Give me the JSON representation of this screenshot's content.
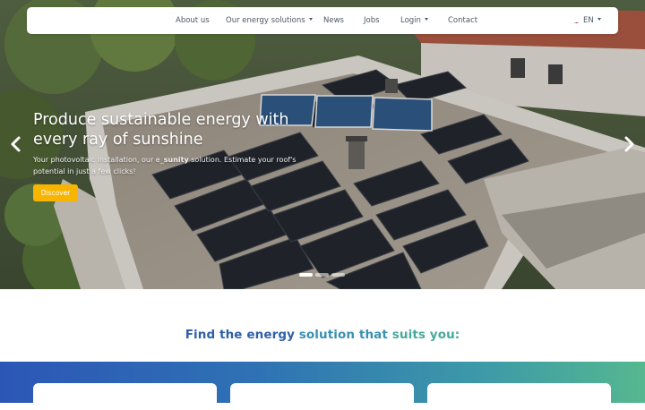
{
  "nav": {
    "items": [
      {
        "label": "About us"
      },
      {
        "label": "Our energy solutions"
      },
      {
        "label": "News"
      },
      {
        "label": "Jobs"
      },
      {
        "label": "Login"
      },
      {
        "label": "Contact"
      }
    ],
    "language": "EN"
  },
  "hero": {
    "title": "Produce sustainable energy with every ray of sunshine",
    "description_pre": "Your photovoltaic installation, our e_",
    "description_bold": "sunity",
    "description_post": " solution. Estimate your roof's potential in just a few clicks!",
    "cta_label": "Discover",
    "active_slide": 1,
    "slide_count": 3
  },
  "section": {
    "title_part1": "Find the energy ",
    "title_part2": "solution that ",
    "title_part3": "suits you:"
  },
  "colors": {
    "accent": "#f7b500",
    "heading_blue": "#2f5fa8",
    "heading_teal": "#46a99a",
    "band_start": "#2c56b6",
    "band_end": "#55b88f"
  },
  "icons": {
    "prev": "chevron-left-icon",
    "next": "chevron-right-icon",
    "dropdown": "caret-down-icon",
    "language": "uk-flag-icon"
  }
}
